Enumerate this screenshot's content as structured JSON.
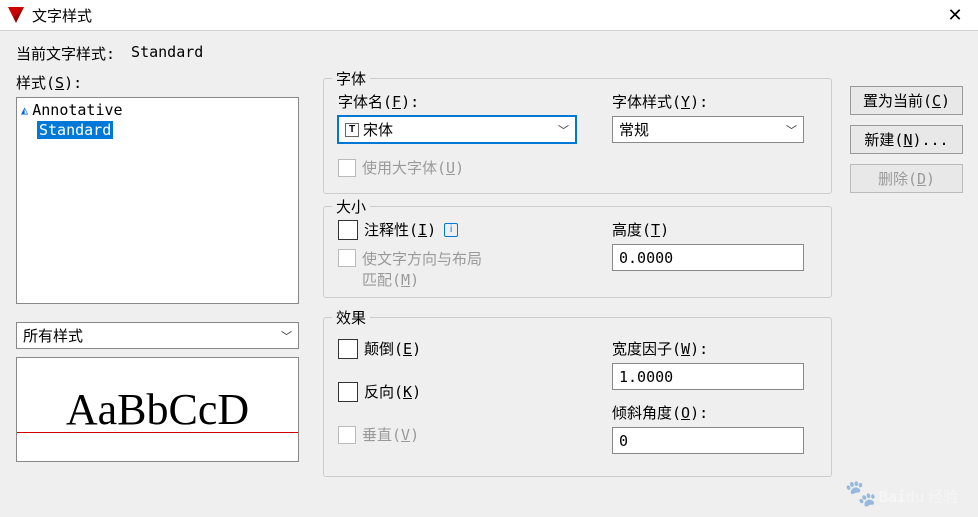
{
  "title": "文字样式",
  "currentLabel": "当前文字样式:",
  "currentValue": "Standard",
  "stylesLabel": "样式(S):",
  "styles": {
    "items": [
      "Annotative",
      "Standard"
    ],
    "selected": "Standard"
  },
  "filterValue": "所有样式",
  "previewSample": "AaBbCcD",
  "font": {
    "group": "字体",
    "nameLabel": "字体名(F):",
    "nameValue": "宋体",
    "styleLabel": "字体样式(Y):",
    "styleValue": "常规",
    "bigfontLabel": "使用大字体(U)"
  },
  "size": {
    "group": "大小",
    "annotLabel": "注释性(I)",
    "matchLabel1": "使文字方向与布局",
    "matchLabel2": "匹配(M)",
    "heightLabel": "高度(T)",
    "heightValue": "0.0000"
  },
  "effects": {
    "group": "效果",
    "upsideLabel": "颠倒(E)",
    "backwardsLabel": "反向(K)",
    "verticalLabel": "垂直(V)",
    "widthLabel": "宽度因子(W):",
    "widthValue": "1.0000",
    "obliqueLabel": "倾斜角度(O):",
    "obliqueValue": "0"
  },
  "buttons": {
    "setCurrent": "置为当前(C)",
    "new": "新建(N)...",
    "delete": "删除(D)"
  },
  "watermark": "Baidu 经验"
}
